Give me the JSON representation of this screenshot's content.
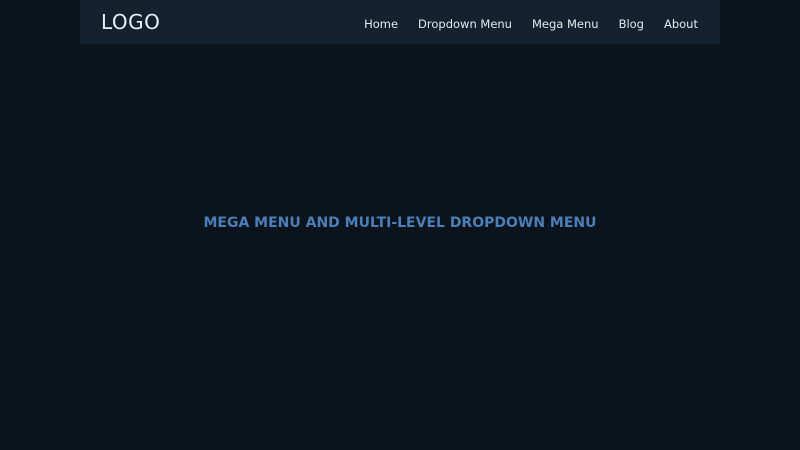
{
  "navbar": {
    "logo": "LOGO",
    "links": [
      {
        "label": "Home"
      },
      {
        "label": "Dropdown Menu"
      },
      {
        "label": "Mega Menu"
      },
      {
        "label": "Blog"
      },
      {
        "label": "About"
      }
    ]
  },
  "main": {
    "title": "MEGA MENU AND MULTI-LEVEL DROPDOWN MENU"
  },
  "colors": {
    "page_background": "#0b131d",
    "navbar_background": "#14222f",
    "title_accent": "#4a7fb8",
    "nav_text": "#e4e9ef"
  }
}
